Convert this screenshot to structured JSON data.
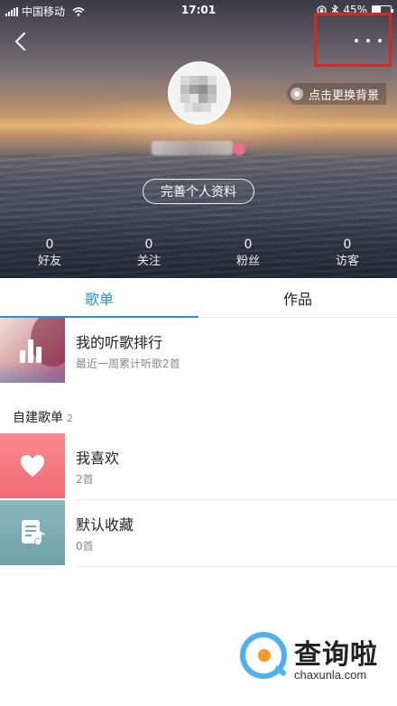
{
  "status_bar": {
    "carrier": "中国移动",
    "time": "17:01",
    "battery": "45%",
    "battery_level": 0.45
  },
  "header": {
    "change_background": "点击更换背景",
    "edit_profile": "完善个人资料",
    "more_highlight_color": "#d5281f"
  },
  "stats": [
    {
      "value": "0",
      "label": "好友"
    },
    {
      "value": "0",
      "label": "关注"
    },
    {
      "value": "0",
      "label": "粉丝"
    },
    {
      "value": "0",
      "label": "访客"
    }
  ],
  "tabs": [
    {
      "label": "歌单",
      "active": true
    },
    {
      "label": "作品",
      "active": false
    }
  ],
  "ranking": {
    "title": "我的听歌排行",
    "subtitle": "最近一周累计听歌2首"
  },
  "custom_playlists": {
    "header": "自建歌单",
    "count": "2",
    "items": [
      {
        "title": "我喜欢",
        "subtitle": "2首",
        "icon": "heart-icon"
      },
      {
        "title": "默认收藏",
        "subtitle": "0首",
        "icon": "music-file-icon"
      }
    ]
  },
  "watermark": {
    "brand": "查询啦",
    "url": "chaxunla.com"
  },
  "colors": {
    "accent": "#2b8fd3"
  }
}
